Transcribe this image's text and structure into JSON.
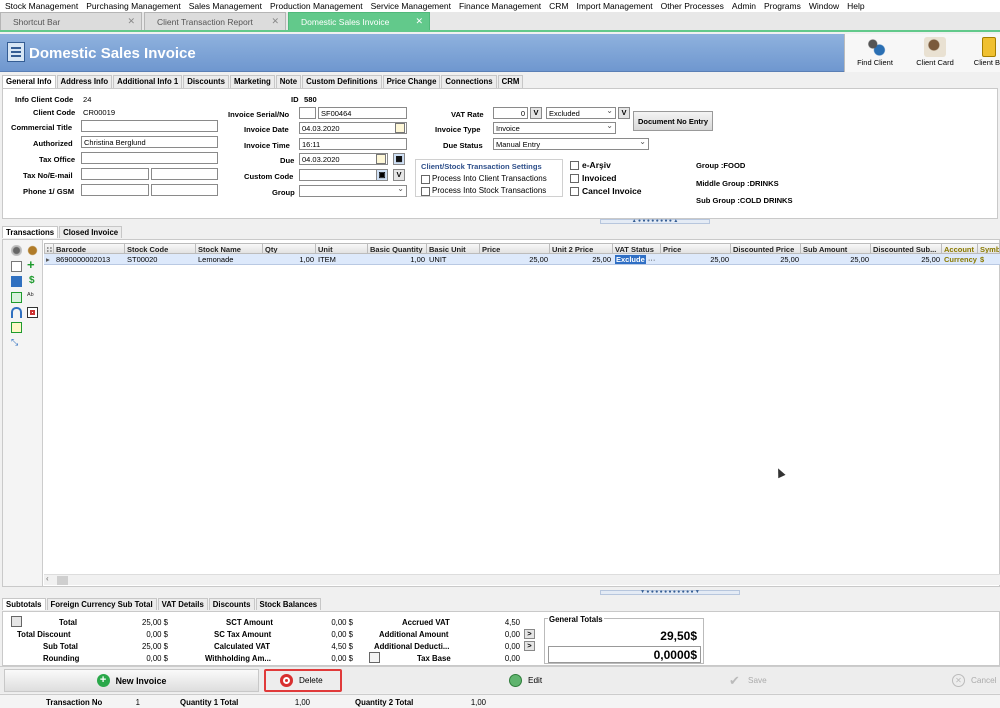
{
  "menu": [
    "Stock Management",
    "Purchasing Management",
    "Sales Management",
    "Production Management",
    "Service Management",
    "Finance Management",
    "CRM",
    "Import Management",
    "Other Processes",
    "Admin",
    "Programs",
    "Window",
    "Help"
  ],
  "doc_tabs": [
    {
      "label": "Shortcut Bar",
      "active": false
    },
    {
      "label": "Client Transaction Report",
      "active": false
    },
    {
      "label": "Domestic Sales Invoice",
      "active": true
    }
  ],
  "window": {
    "title": "Domestic Sales Invoice",
    "tools": {
      "find_client": "Find Client",
      "client_card": "Client Card",
      "client_balance": "Client Ba"
    }
  },
  "info_tabs": [
    "General Info",
    "Address Info",
    "Additional Info 1",
    "Discounts",
    "Marketing",
    "Note",
    "Custom Definitions",
    "Price Change",
    "Connections",
    "CRM"
  ],
  "form": {
    "info_client_code_label": "Info Client Code",
    "info_client_code": "24",
    "client_code_label": "Client Code",
    "client_code": "CR00019",
    "id_label": "ID",
    "id": "580",
    "commercial_title_label": "Commercial Title",
    "commercial_title": "",
    "authorized_label": "Authorized",
    "authorized": "Christina Berglund",
    "tax_office_label": "Tax Office",
    "tax_office": "",
    "tax_no_label": "Tax No/E-mail",
    "phone_label": "Phone 1/ GSM",
    "invoice_serial_label": "Invoice Serial/No",
    "invoice_serial": "",
    "invoice_no": "SF00464",
    "invoice_date_label": "Invoice Date",
    "invoice_date": "04.03.2020",
    "invoice_time_label": "Invoice Time",
    "invoice_time": "16:11",
    "due_label": "Due",
    "due": "04.03.2020",
    "custom_code_label": "Custom Code",
    "custom_code": "",
    "group_label": "Group",
    "group": "",
    "vat_rate_label": "VAT Rate",
    "vat_rate": "0",
    "vat_btn": "V",
    "vat_mode": "Excluded",
    "vat_btn2": "V",
    "invoice_type_label": "Invoice Type",
    "invoice_type": "Invoice",
    "due_status_label": "Due Status",
    "due_status": "Manual Entry",
    "document_no_entry": "Document No Entry",
    "settings_title": "Client/Stock Transaction Settings",
    "process_client": "Process Into Client Transactions",
    "process_stock": "Process Into Stock Transactions",
    "e_arsiv": "e-Arşiv",
    "invoiced": "Invoiced",
    "cancel_invoice": "Cancel Invoice",
    "group_info": "Group :FOOD",
    "middle_group_info": "Middle Group :DRINKS",
    "sub_group_info": "Sub Group :COLD DRINKS",
    "custom_code_btn": "V"
  },
  "trans_tabs": [
    "Transactions",
    "Closed Invoice"
  ],
  "grid": {
    "columns": [
      "Barcode",
      "Stock Code",
      "Stock Name",
      "Qty",
      "Unit",
      "Basic Quantity",
      "Basic Unit",
      "Price",
      "Unit 2 Price",
      "VAT Status",
      "Price",
      "Discounted Price",
      "Sub Amount",
      "Discounted Sub...",
      "Account",
      "Symb"
    ],
    "rows": [
      {
        "barcode": "8690000002013",
        "stock_code": "ST00020",
        "stock_name": "Lemonade",
        "qty": "1,00",
        "unit": "ITEM",
        "basic_qty": "1,00",
        "basic_unit": "UNIT",
        "price": "25,00",
        "unit2_price": "25,00",
        "vat_status": "Exclude",
        "vat_more": "···",
        "price2": "25,00",
        "discounted_price": "25,00",
        "sub_amount": "25,00",
        "discounted_sub": "25,00",
        "account": "Currency",
        "symbol": "$"
      }
    ]
  },
  "bottom_tabs": [
    "Subtotals",
    "Foreign Currency Sub Total",
    "VAT Details",
    "Discounts",
    "Stock Balances"
  ],
  "subtotals": {
    "total_label": "Total",
    "total": "25,00 $",
    "total_discount_label": "Total Discount",
    "total_discount": "0,00 $",
    "sub_total_label": "Sub Total",
    "sub_total": "25,00 $",
    "rounding_label": "Rounding",
    "rounding": "0,00 $",
    "sct_amount_label": "SCT Amount",
    "sct_amount": "0,00 $",
    "sc_tax_amount_label": "SC Tax Amount",
    "sc_tax_amount": "0,00 $",
    "calculated_vat_label": "Calculated VAT",
    "calculated_vat": "4,50 $",
    "withholding_label": "Withholding Am...",
    "withholding": "0,00 $",
    "accrued_vat_label": "Accrued VAT",
    "accrued_vat": "4,50",
    "additional_amount_label": "Additional Amount",
    "additional_amount": "0,00",
    "additional_deduction_label": "Additional Deducti...",
    "additional_deduction": "0,00",
    "tax_base_label": "Tax Base",
    "tax_base": "0,00",
    "general_totals_label": "General Totals",
    "general_total": "29,50$",
    "general_total_2": "0,0000$"
  },
  "actions": {
    "new_invoice": "New Invoice",
    "delete": "Delete",
    "edit": "Edit",
    "save": "Save",
    "cancel": "Cancel"
  },
  "status": {
    "transaction_no_label": "Transaction No",
    "transaction_no": "1",
    "qty1_total_label": "Quantity 1 Total",
    "qty1_total": "1,00",
    "qty2_total_label": "Quantity 2 Total",
    "qty2_total": "1,00"
  },
  "colors": {
    "accent_tab": "#62c98b",
    "title_bar": "#7ea4d8",
    "delete_highlight": "#e03a3a",
    "row_select": "#dde9fb"
  }
}
